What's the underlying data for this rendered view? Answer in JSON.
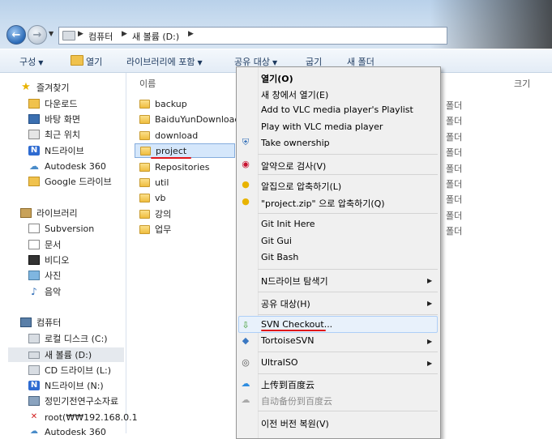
{
  "address": {
    "crumbs": [
      "컴퓨터",
      "새 볼륨 (D:)"
    ]
  },
  "toolbar": {
    "organize": "구성",
    "open": "열기",
    "include_library": "라이브러리에 포함",
    "share_with": "공유 대상",
    "burn": "굽기",
    "new_folder": "새 폴더"
  },
  "columns": {
    "name": "이름",
    "size": "크기"
  },
  "nav": {
    "favorites": "즐겨찾기",
    "fav_items": [
      "다운로드",
      "바탕 화면",
      "최근 위치",
      "N드라이브",
      "Autodesk 360",
      "Google 드라이브"
    ],
    "libraries": "라이브러리",
    "lib_items": [
      "Subversion",
      "문서",
      "비디오",
      "사진",
      "음악"
    ],
    "computer": "컴퓨터",
    "comp_items": [
      "로컬 디스크 (C:)",
      "새 볼륨 (D:)",
      "CD 드라이브 (L:)",
      "N드라이브 (N:)",
      "정민기전연구소자료",
      "root(₩₩192.168.0.1",
      "Autodesk 360"
    ]
  },
  "files": [
    "backup",
    "BaiduYunDownload",
    "download",
    "project",
    "Repositories",
    "util",
    "vb",
    "강의",
    "업무"
  ],
  "file_type_partial": "폴더",
  "context_menu": {
    "open": "열기(O)",
    "open_new_window": "새 창에서 열기(E)",
    "vlc_add": "Add to VLC media player's Playlist",
    "vlc_play": "Play with VLC media player",
    "take_ownership": "Take ownership",
    "alyac_scan": "알약으로 검사(V)",
    "alzip_compress": "알집으로 압축하기(L)",
    "alzip_compress_zip": "\"project.zip\" 으로 압축하기(Q)",
    "git_init": "Git Init Here",
    "git_gui": "Git Gui",
    "git_bash": "Git Bash",
    "ndrive_explorer": "N드라이브 탐색기",
    "share_with": "공유 대상(H)",
    "svn_checkout": "SVN Checkout...",
    "tortoise_svn": "TortoiseSVN",
    "ultraiso": "UltraISO",
    "baidu_upload": "上传到百度云",
    "baidu_backup": "自动备份到百度云",
    "restore_prev": "이전 버전 복원(V)"
  },
  "colors": {
    "accent_underline": "#e0171b",
    "menu_bg": "#f0f0f0",
    "titlebar": "#c9dcef"
  }
}
